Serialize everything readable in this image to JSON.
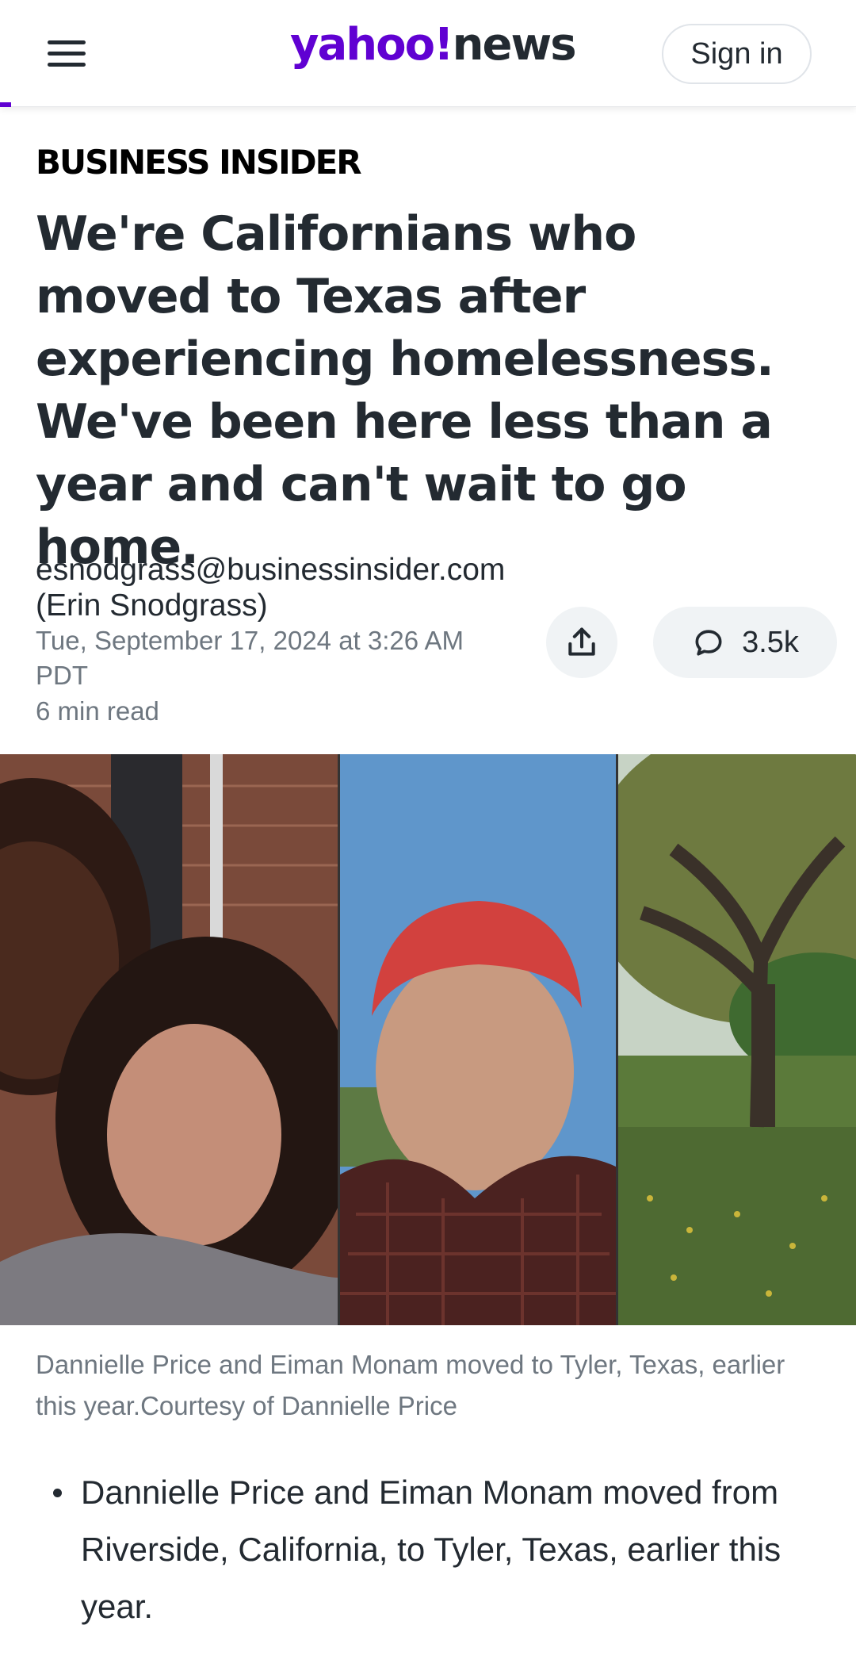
{
  "header": {
    "logo_primary": "yahoo!",
    "logo_secondary": "news",
    "sign_in_label": "Sign in",
    "brand_color": "#6001d2"
  },
  "article": {
    "publisher": "BUSINESS INSIDER",
    "headline": "We're Californians who moved to Texas after experiencing homelessness. We've been here less than a year and can't wait to go home.",
    "author": "esnodgrass@businessinsider.com (Erin Snodgrass)",
    "date": "Tue, September 17, 2024 at 3:26 AM PDT",
    "read_time": "6 min read",
    "comments_count": "3.5k",
    "image_caption": "Dannielle Price and Eiman Monam moved to Tyler, Texas, earlier this year.Courtesy of Dannielle Price",
    "bullets": [
      "Dannielle Price and Eiman Monam moved from Riverside, California, to Tyler, Texas, earlier this year."
    ]
  },
  "icons": {
    "menu": "hamburger-menu-icon",
    "share": "share-icon",
    "comments": "comment-bubble-icon"
  }
}
